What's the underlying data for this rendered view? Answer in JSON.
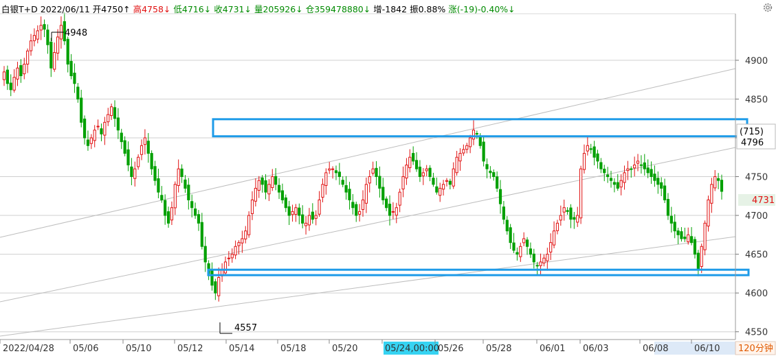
{
  "header": {
    "name": "白银T+D",
    "date": "2022/06/11",
    "open": "开4750↑",
    "high": "高4758↓",
    "low": "低4716↓",
    "close": "收4731↓",
    "volume": "量205926↓",
    "position": "仓359478880↓",
    "increase": "增-1842",
    "amplitude": "振0.88%",
    "change": "涨(-19)-0.40%↓"
  },
  "colors": {
    "up": "#e01010",
    "down": "#00a000",
    "box": "#1e9be8",
    "grid": "#cfcfcf",
    "channel": "#bdbdbd",
    "price_tag_bg": "#e6f2e6",
    "date_highlight": "#36d3f2"
  },
  "chart_data": {
    "type": "candlestick",
    "y_axis_ticks": [
      4550,
      4600,
      4650,
      4700,
      4750,
      4800,
      4850,
      4900
    ],
    "ylim": [
      4540,
      4960
    ],
    "x_axis_labels": [
      "2022/04/28",
      "05/06",
      "05/10",
      "05/12",
      "05/14",
      "05/18",
      "05/20",
      "05/24,00:00",
      "05/26",
      "05/28",
      "06/01",
      "06/03",
      "06/08",
      "06/10"
    ],
    "period_label": "120分钟",
    "annotations": {
      "high_label": "4948",
      "low_label": "4557",
      "box_upper_label_a": "(715)",
      "box_upper_label_b": "4796",
      "last_price": "4731"
    },
    "boxes": [
      {
        "y_top": 4824,
        "y_bottom": 4802
      },
      {
        "y_top": 4630,
        "y_bottom": 4623
      }
    ],
    "close_series": [
      4885,
      4870,
      4862,
      4878,
      4890,
      4880,
      4895,
      4912,
      4925,
      4932,
      4938,
      4945,
      4940,
      4920,
      4890,
      4910,
      4930,
      4945,
      4925,
      4895,
      4880,
      4870,
      4850,
      4820,
      4800,
      4790,
      4800,
      4810,
      4815,
      4805,
      4820,
      4830,
      4840,
      4825,
      4810,
      4795,
      4780,
      4765,
      4750,
      4760,
      4775,
      4790,
      4800,
      4780,
      4760,
      4745,
      4730,
      4720,
      4700,
      4690,
      4710,
      4740,
      4760,
      4750,
      4735,
      4720,
      4710,
      4700,
      4690,
      4660,
      4640,
      4625,
      4610,
      4600,
      4620,
      4630,
      4640,
      4645,
      4650,
      4660,
      4665,
      4670,
      4680,
      4700,
      4720,
      4735,
      4745,
      4740,
      4730,
      4740,
      4750,
      4740,
      4730,
      4720,
      4710,
      4700,
      4705,
      4710,
      4700,
      4690,
      4690,
      4700,
      4695,
      4700,
      4720,
      4740,
      4755,
      4760,
      4760,
      4755,
      4750,
      4740,
      4730,
      4720,
      4710,
      4700,
      4705,
      4720,
      4740,
      4750,
      4760,
      4750,
      4735,
      4720,
      4710,
      4700,
      4705,
      4710,
      4730,
      4750,
      4765,
      4775,
      4770,
      4760,
      4750,
      4755,
      4760,
      4750,
      4740,
      4730,
      4735,
      4740,
      4745,
      4740,
      4760,
      4775,
      4780,
      4785,
      4790,
      4800,
      4810,
      4805,
      4790,
      4770,
      4760,
      4755,
      4750,
      4735,
      4715,
      4695,
      4680,
      4665,
      4655,
      4650,
      4660,
      4670,
      4660,
      4650,
      4640,
      4635,
      4640,
      4645,
      4650,
      4665,
      4680,
      4690,
      4700,
      4710,
      4705,
      4695,
      4695,
      4700,
      4760,
      4780,
      4790,
      4785,
      4775,
      4770,
      4760,
      4755,
      4750,
      4745,
      4740,
      4735,
      4745,
      4755,
      4760,
      4760,
      4765,
      4770,
      4765,
      4760,
      4755,
      4750,
      4745,
      4740,
      4735,
      4720,
      4700,
      4690,
      4680,
      4675,
      4670,
      4670,
      4675,
      4665,
      4650,
      4630,
      4660,
      4690,
      4720,
      4740,
      4750,
      4745,
      4731
    ]
  }
}
